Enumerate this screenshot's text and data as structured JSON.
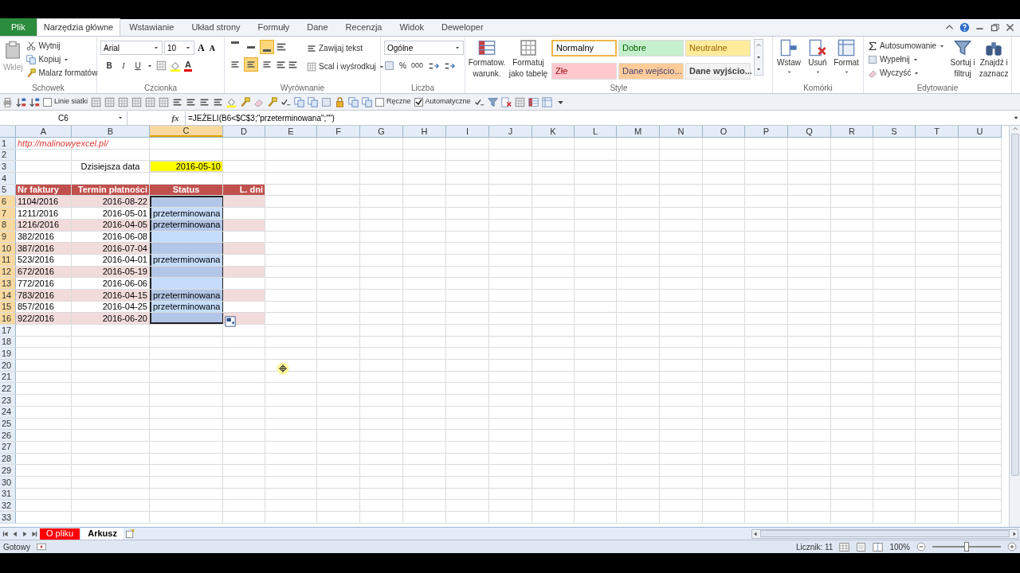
{
  "ribbon": {
    "tabs": [
      {
        "label": "Plik",
        "kind": "file",
        "selected": false
      },
      {
        "label": "Narzędzia główne",
        "kind": "tab",
        "selected": true
      },
      {
        "label": "Wstawianie",
        "kind": "tab",
        "selected": false
      },
      {
        "label": "Układ strony",
        "kind": "tab",
        "selected": false
      },
      {
        "label": "Formuły",
        "kind": "tab",
        "selected": false
      },
      {
        "label": "Dane",
        "kind": "tab",
        "selected": false
      },
      {
        "label": "Recenzja",
        "kind": "tab",
        "selected": false
      },
      {
        "label": "Widok",
        "kind": "tab",
        "selected": false
      },
      {
        "label": "Deweloper",
        "kind": "tab",
        "selected": false
      }
    ],
    "clipboard": {
      "label": "Schowek",
      "paste": "Wklej",
      "items": [
        "Wytnij",
        "Kopiuj",
        "Malarz formatów"
      ]
    },
    "font": {
      "label": "Czcionka",
      "family": "Arial",
      "size": "10",
      "size_buttons": [
        "A",
        "A"
      ],
      "styles": [
        "B",
        "I",
        "U"
      ],
      "color_button": "A"
    },
    "alignment": {
      "label": "Wyrównanie",
      "vertical": [
        {
          "selected": false
        },
        {
          "selected": false
        },
        {
          "selected": true
        }
      ],
      "horizontal": [
        {
          "selected": false
        },
        {
          "selected": true
        },
        {
          "selected": false
        }
      ],
      "wrap": "Zawijaj tekst",
      "merge": "Scal i wyśrodkuj"
    },
    "number": {
      "label": "Liczba",
      "format": "Ogólne",
      "percent": "%",
      "thousands": "000"
    },
    "styles": {
      "label": "Style",
      "conditional": [
        "Formatow.",
        "warunk."
      ],
      "as_table": [
        "Formatuj",
        "jako tabelę"
      ],
      "cell_styles": [
        {
          "label": "Normalny",
          "color": "#ffffff",
          "selected": true
        },
        {
          "label": "Dobre",
          "color": "#c6efce",
          "selected": false
        },
        {
          "label": "Neutralne",
          "color": "#ffeb9c",
          "selected": false
        },
        {
          "label": "Złe",
          "color": "#ffc7ce",
          "selected": false
        },
        {
          "label": "Dane wejścio...",
          "color": "#ffcc99",
          "selected": false
        },
        {
          "label": "Dane wyjścio...",
          "color": "#f2f2f2",
          "selected": false
        }
      ]
    },
    "cells": {
      "label": "Komórki",
      "buttons": [
        "Wstaw",
        "Usuń",
        "Format"
      ]
    },
    "editing": {
      "label": "Edytowanie",
      "items": [
        "Autosumowanie",
        "Wypełnij",
        "Wyczyść"
      ],
      "sort": [
        "Sortuj i",
        "filtruj"
      ],
      "find": [
        "Znajdź i",
        "zaznacz"
      ]
    }
  },
  "quick_toolbar": {
    "checkboxes": [
      {
        "label": "Linie siatki",
        "checked": false
      },
      {
        "label": "Ręczne",
        "checked": false
      },
      {
        "label": "Automatyczne",
        "checked": true
      }
    ]
  },
  "formula_bar": {
    "name_box": "C6",
    "fx": "fx",
    "formula": "=JEŻELI(B6<$C$3;\"przeterminowana\";\"\")"
  },
  "column_headers": [
    {
      "label": "A",
      "selected": false
    },
    {
      "label": "B",
      "selected": false
    },
    {
      "label": "C",
      "selected": true
    },
    {
      "label": "D",
      "selected": false
    },
    {
      "label": "E",
      "selected": false
    },
    {
      "label": "F",
      "selected": false
    },
    {
      "label": "G",
      "selected": false
    },
    {
      "label": "H",
      "selected": false
    },
    {
      "label": "I",
      "selected": false
    },
    {
      "label": "J",
      "selected": false
    },
    {
      "label": "K",
      "selected": false
    },
    {
      "label": "L",
      "selected": false
    },
    {
      "label": "M",
      "selected": false
    },
    {
      "label": "N",
      "selected": false
    },
    {
      "label": "O",
      "selected": false
    },
    {
      "label": "P",
      "selected": false
    },
    {
      "label": "Q",
      "selected": false
    },
    {
      "label": "R",
      "selected": false
    },
    {
      "label": "S",
      "selected": false
    },
    {
      "label": "T",
      "selected": false
    },
    {
      "label": "U",
      "selected": false
    }
  ],
  "row_headers": [
    {
      "label": "1",
      "selected": false
    },
    {
      "label": "2",
      "selected": false
    },
    {
      "label": "3",
      "selected": false
    },
    {
      "label": "4",
      "selected": false
    },
    {
      "label": "5",
      "selected": false
    },
    {
      "label": "6",
      "selected": true
    },
    {
      "label": "7",
      "selected": true
    },
    {
      "label": "8",
      "selected": true
    },
    {
      "label": "9",
      "selected": true
    },
    {
      "label": "10",
      "selected": true
    },
    {
      "label": "11",
      "selected": true
    },
    {
      "label": "12",
      "selected": true
    },
    {
      "label": "13",
      "selected": true
    },
    {
      "label": "14",
      "selected": true
    },
    {
      "label": "15",
      "selected": true
    },
    {
      "label": "16",
      "selected": true
    },
    {
      "label": "17",
      "selected": false
    },
    {
      "label": "18",
      "selected": false
    },
    {
      "label": "19",
      "selected": false
    },
    {
      "label": "20",
      "selected": false
    },
    {
      "label": "21",
      "selected": false
    },
    {
      "label": "22",
      "selected": false
    },
    {
      "label": "23",
      "selected": false
    },
    {
      "label": "24",
      "selected": false
    },
    {
      "label": "25",
      "selected": false
    },
    {
      "label": "26",
      "selected": false
    },
    {
      "label": "27",
      "selected": false
    },
    {
      "label": "28",
      "selected": false
    },
    {
      "label": "29",
      "selected": false
    },
    {
      "label": "30",
      "selected": false
    },
    {
      "label": "31",
      "selected": false
    },
    {
      "label": "32",
      "selected": false
    },
    {
      "label": "33",
      "selected": false
    }
  ],
  "sheet": {
    "link": "http://malinowyexcel.pl/",
    "today_label": "Dzisiejsza data",
    "today_value": "2016-05-10",
    "table": {
      "columns": [
        "Nr faktury",
        "Termin płatności",
        "Status",
        "L. dni"
      ],
      "rows": [
        {
          "invoice": "1104/2016",
          "due": "2016-08-22",
          "selected": true
        },
        {
          "invoice": "1211/2016",
          "due": "2016-05-01",
          "status": "przeterminowana",
          "selected": true
        },
        {
          "invoice": "1216/2016",
          "due": "2016-04-05",
          "status": "przeterminowana",
          "selected": true
        },
        {
          "invoice": "382/2016",
          "due": "2016-06-08",
          "selected": true
        },
        {
          "invoice": "387/2016",
          "due": "2016-07-04",
          "selected": true
        },
        {
          "invoice": "523/2016",
          "due": "2016-04-01",
          "status": "przeterminowana",
          "selected": true
        },
        {
          "invoice": "672/2016",
          "due": "2016-05-19",
          "selected": true
        },
        {
          "invoice": "772/2016",
          "due": "2016-06-06",
          "selected": true
        },
        {
          "invoice": "783/2016",
          "due": "2016-04-15",
          "status": "przeterminowana",
          "selected": true
        },
        {
          "invoice": "857/2016",
          "due": "2016-04-25",
          "status": "przeterminowana",
          "selected": true
        },
        {
          "invoice": "922/2016",
          "due": "2016-06-20",
          "selected": true
        }
      ]
    }
  },
  "sheet_tabs": [
    {
      "label": "O pliku",
      "color": "#ff0000",
      "selected": false
    },
    {
      "label": "Arkusz",
      "selected": true
    }
  ],
  "status_bar": {
    "state": "Gotowy",
    "count": "Licznik: 11",
    "zoom": "100%",
    "zoom_slider": {
      "level": 0.5
    }
  }
}
